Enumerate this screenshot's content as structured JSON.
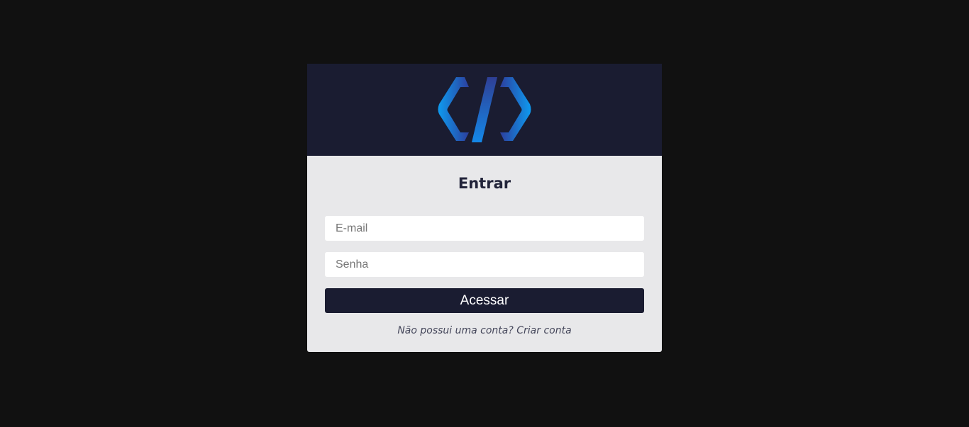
{
  "header": {
    "logo_icon": "code-brackets-logo-icon",
    "accent_colors": [
      "#2f4fb3",
      "#0e9aef",
      "#1a1c31"
    ]
  },
  "login": {
    "title": "Entrar",
    "email_placeholder": "E-mail",
    "password_placeholder": "Senha",
    "submit_label": "Acessar",
    "signup_prompt": "Não possui uma conta?",
    "signup_link": "Criar conta"
  }
}
